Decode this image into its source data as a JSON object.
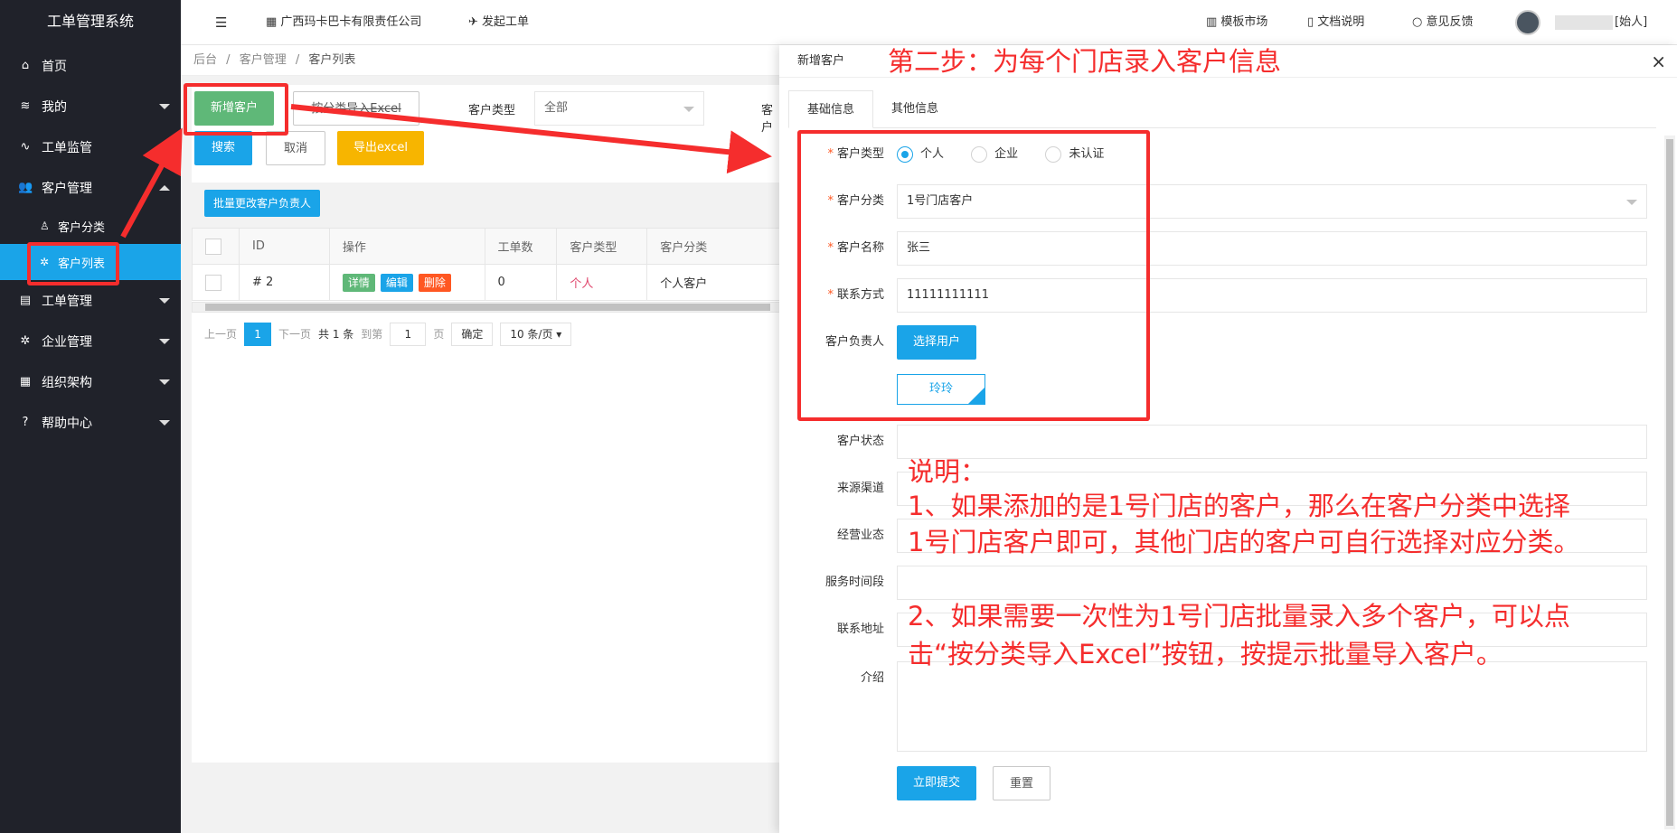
{
  "app": {
    "title": "工单管理系统"
  },
  "header": {
    "menu_toggle": "☰",
    "company": "广西玛卡巴卡有限责任公司",
    "create_ticket": "发起工单",
    "template_market": "模板市场",
    "docs": "文档说明",
    "feedback": "意见反馈",
    "user_name": "[始人]"
  },
  "sidebar": {
    "items": [
      {
        "label": "首页",
        "icon": "⌂"
      },
      {
        "label": "我的",
        "icon": "≋"
      },
      {
        "label": "工单监管",
        "icon": "∿"
      },
      {
        "label": "客户管理",
        "icon": "👥"
      },
      {
        "label": "客户分类",
        "icon": "♙"
      },
      {
        "label": "客户列表",
        "icon": "✲"
      },
      {
        "label": "工单管理",
        "icon": "▤"
      },
      {
        "label": "企业管理",
        "icon": "✲"
      },
      {
        "label": "组织架构",
        "icon": "▦"
      },
      {
        "label": "帮助中心",
        "icon": "?"
      }
    ]
  },
  "breadcrumb": {
    "root": "后台",
    "sep": "/",
    "mid": "客户管理",
    "current": "客户列表"
  },
  "toolbar": {
    "add_customer": "新增客户",
    "import_excel": "按分类导入Excel",
    "customer_type_label": "客户类型",
    "customer_type_value": "全部",
    "cut_label": "客户",
    "search": "搜索",
    "cancel": "取消",
    "export": "导出excel",
    "batch_owner": "批量更改客户负责人"
  },
  "table": {
    "headers": [
      "ID",
      "操作",
      "工单数",
      "客户类型",
      "客户分类"
    ],
    "rows": [
      {
        "id": "# 2",
        "actions": [
          "详情",
          "编辑",
          "删除"
        ],
        "tickets": "0",
        "type": "个人",
        "category": "个人客户"
      }
    ]
  },
  "pager": {
    "prev": "上一页",
    "page": "1",
    "next": "下一页",
    "total": "共 1 条",
    "goto": "到第",
    "goto_value": "1",
    "page_unit": "页",
    "confirm": "确定",
    "page_size": "10 条/页"
  },
  "drawer": {
    "title": "新增客户",
    "close": "×",
    "tabs": [
      "基础信息",
      "其他信息"
    ],
    "form": {
      "type_label": "客户类型",
      "type_options": [
        "个人",
        "企业",
        "未认证"
      ],
      "category_label": "客户分类",
      "category_value": "1号门店客户",
      "name_label": "客户名称",
      "name_value": "张三",
      "contact_label": "联系方式",
      "contact_value": "11111111111",
      "owner_label": "客户负责人",
      "owner_button": "选择用户",
      "owner_tag": "玲玲",
      "status_label": "客户状态",
      "source_label": "来源渠道",
      "business_label": "经营业态",
      "service_label": "服务时间段",
      "address_label": "联系地址",
      "intro_label": "介绍",
      "submit": "立即提交",
      "reset": "重置"
    }
  },
  "annotations": {
    "step2": "第二步：为每个门店录入客户信息",
    "note_title": "说明：",
    "note_1a": "1、如果添加的是1号门店的客户，那么在客户分类中选择",
    "note_1b": "1号门店客户即可，其他门店的客户可自行选择对应分类。",
    "note_2a": "2、如果需要一次性为1号门店批量录入多个客户，可以点",
    "note_2b": "击“按分类导入Excel”按钮，按提示批量导入客户。",
    "color": "#f52d2d"
  }
}
